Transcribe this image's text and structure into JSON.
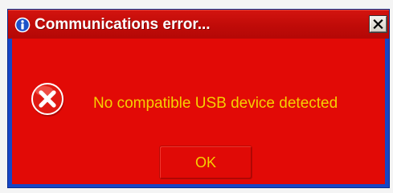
{
  "dialog": {
    "title": "Communications error...",
    "title_icon": "info-icon",
    "close_icon": "close-icon",
    "message_icon": "error-icon",
    "message": "No compatible USB device detected",
    "ok_label": "OK"
  },
  "colors": {
    "frame": "#1646c6",
    "titlebar": "#c00b08",
    "client_background": "#e20a06",
    "text_accent": "#f6d000"
  }
}
